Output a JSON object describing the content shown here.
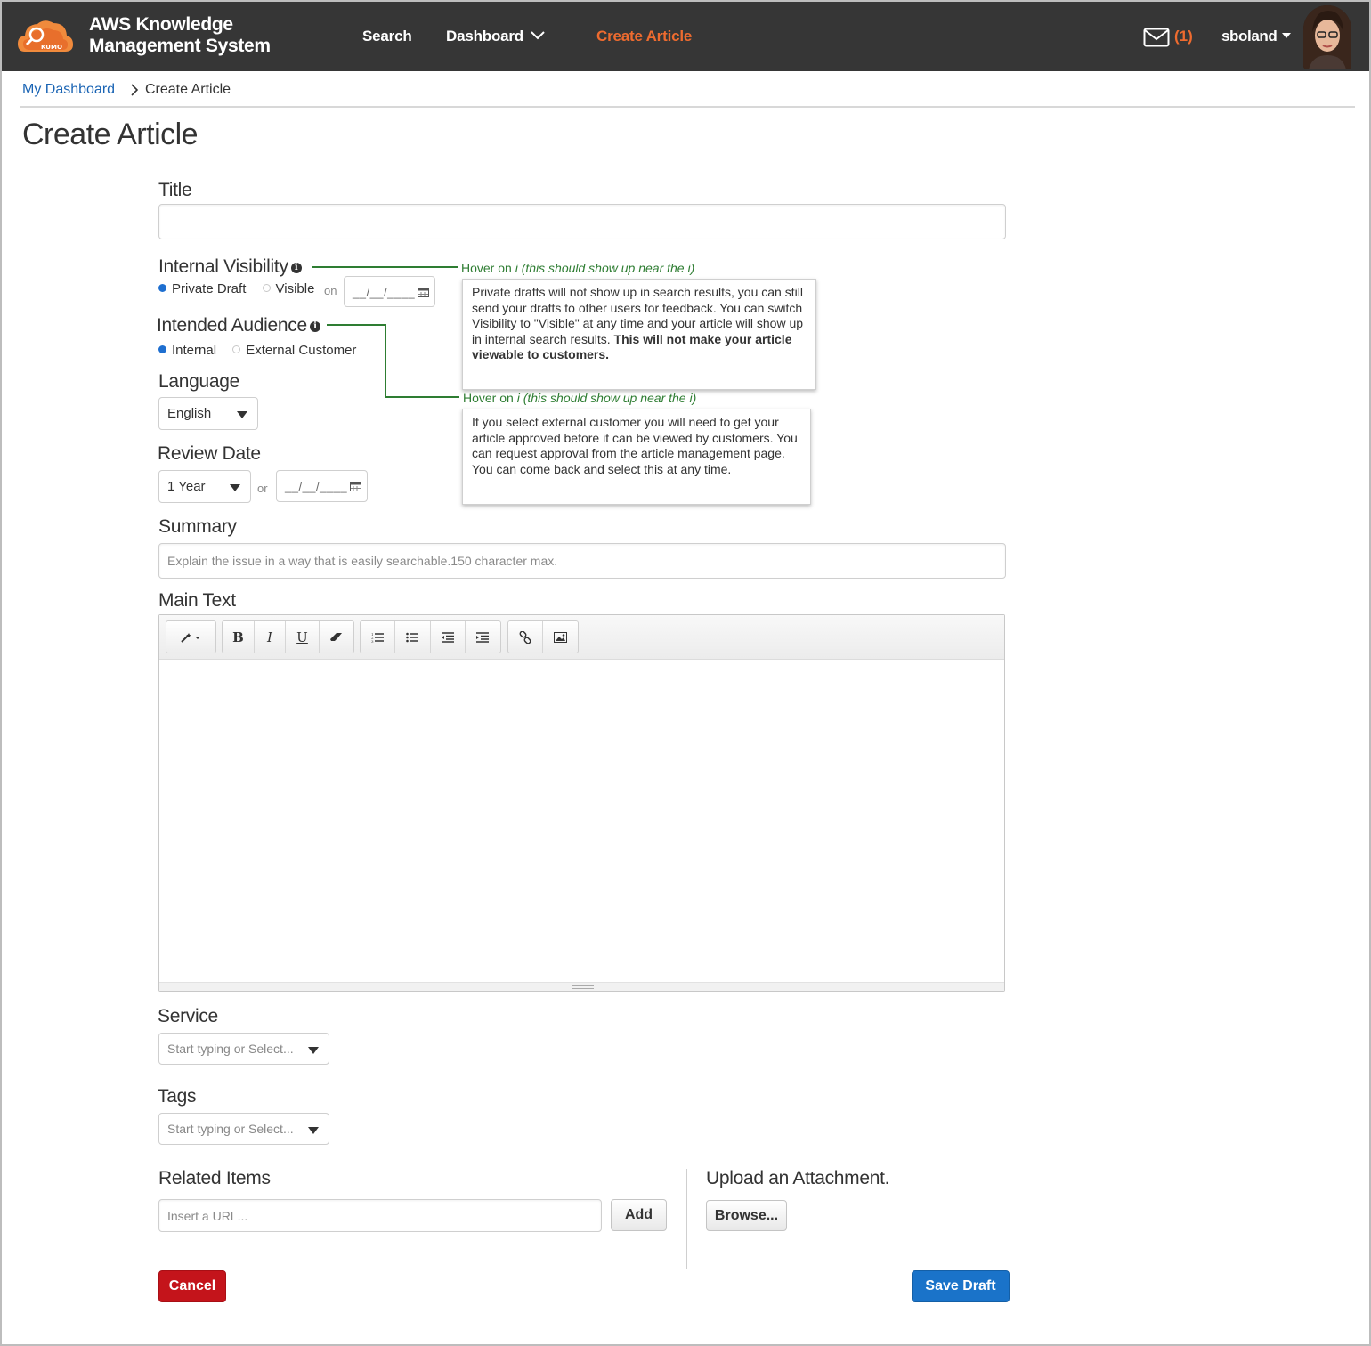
{
  "header": {
    "brand_line1": "AWS Knowledge",
    "brand_line2": "Management System",
    "logo_text": "KUMO",
    "nav": {
      "search": "Search",
      "dashboard": "Dashboard",
      "create_article": "Create Article"
    },
    "mail_count": "(1)",
    "username": "sboland"
  },
  "breadcrumb": {
    "home": "My Dashboard",
    "current": "Create Article"
  },
  "page_title": "Create Article",
  "form": {
    "title_label": "Title",
    "title_value": "",
    "visibility": {
      "label": "Internal Visibility",
      "options": [
        "Private Draft",
        "Visible"
      ],
      "selected": "Private Draft",
      "on_label": "on",
      "date_placeholder": "__/__/____"
    },
    "audience": {
      "label": "Intended Audience",
      "options": [
        "Internal",
        "External Customer"
      ],
      "selected": "Internal"
    },
    "language": {
      "label": "Language",
      "value": "English"
    },
    "review_date": {
      "label": "Review Date",
      "value": "1 Year",
      "or_label": "or",
      "date_placeholder": "__/__/____"
    },
    "summary": {
      "label": "Summary",
      "placeholder": "Explain the issue in a way that is easily searchable.150 character max."
    },
    "main_text": {
      "label": "Main Text",
      "value": ""
    },
    "service": {
      "label": "Service",
      "placeholder": "Start typing or Select..."
    },
    "tags": {
      "label": "Tags",
      "placeholder": "Start typing or Select..."
    },
    "related_items": {
      "label": "Related Items",
      "placeholder": "Insert a URL...",
      "add_label": "Add"
    },
    "attachment": {
      "label": "Upload an Attachment.",
      "browse_label": "Browse..."
    }
  },
  "annotations": {
    "visibility_hint": {
      "prefix": "Hover on ",
      "italic": "i (this should show up near the i)"
    },
    "visibility_tip": {
      "text": "Private drafts will not show up in search results, you can still send your drafts to other users for feedback. You can switch Visibility to \"Visible\" at any time and your article will show up in internal search results. ",
      "bold": "This will not make your article viewable to customers."
    },
    "audience_hint": {
      "prefix": "Hover on ",
      "italic": "i (this should show up near the i)"
    },
    "audience_tip": {
      "text": "If you select external customer you will need to get your article approved before it can be viewed by customers. You can request approval from the article management page. You can come back and select this at any time."
    }
  },
  "actions": {
    "cancel": "Cancel",
    "save_draft": "Save Draft"
  },
  "colors": {
    "topbar": "#363636",
    "accent_orange": "#ee6b2f",
    "link_blue": "#1a64b4",
    "cancel_red": "#c4141b",
    "save_blue": "#1a73c9",
    "annotation_green": "#2e7d32"
  }
}
